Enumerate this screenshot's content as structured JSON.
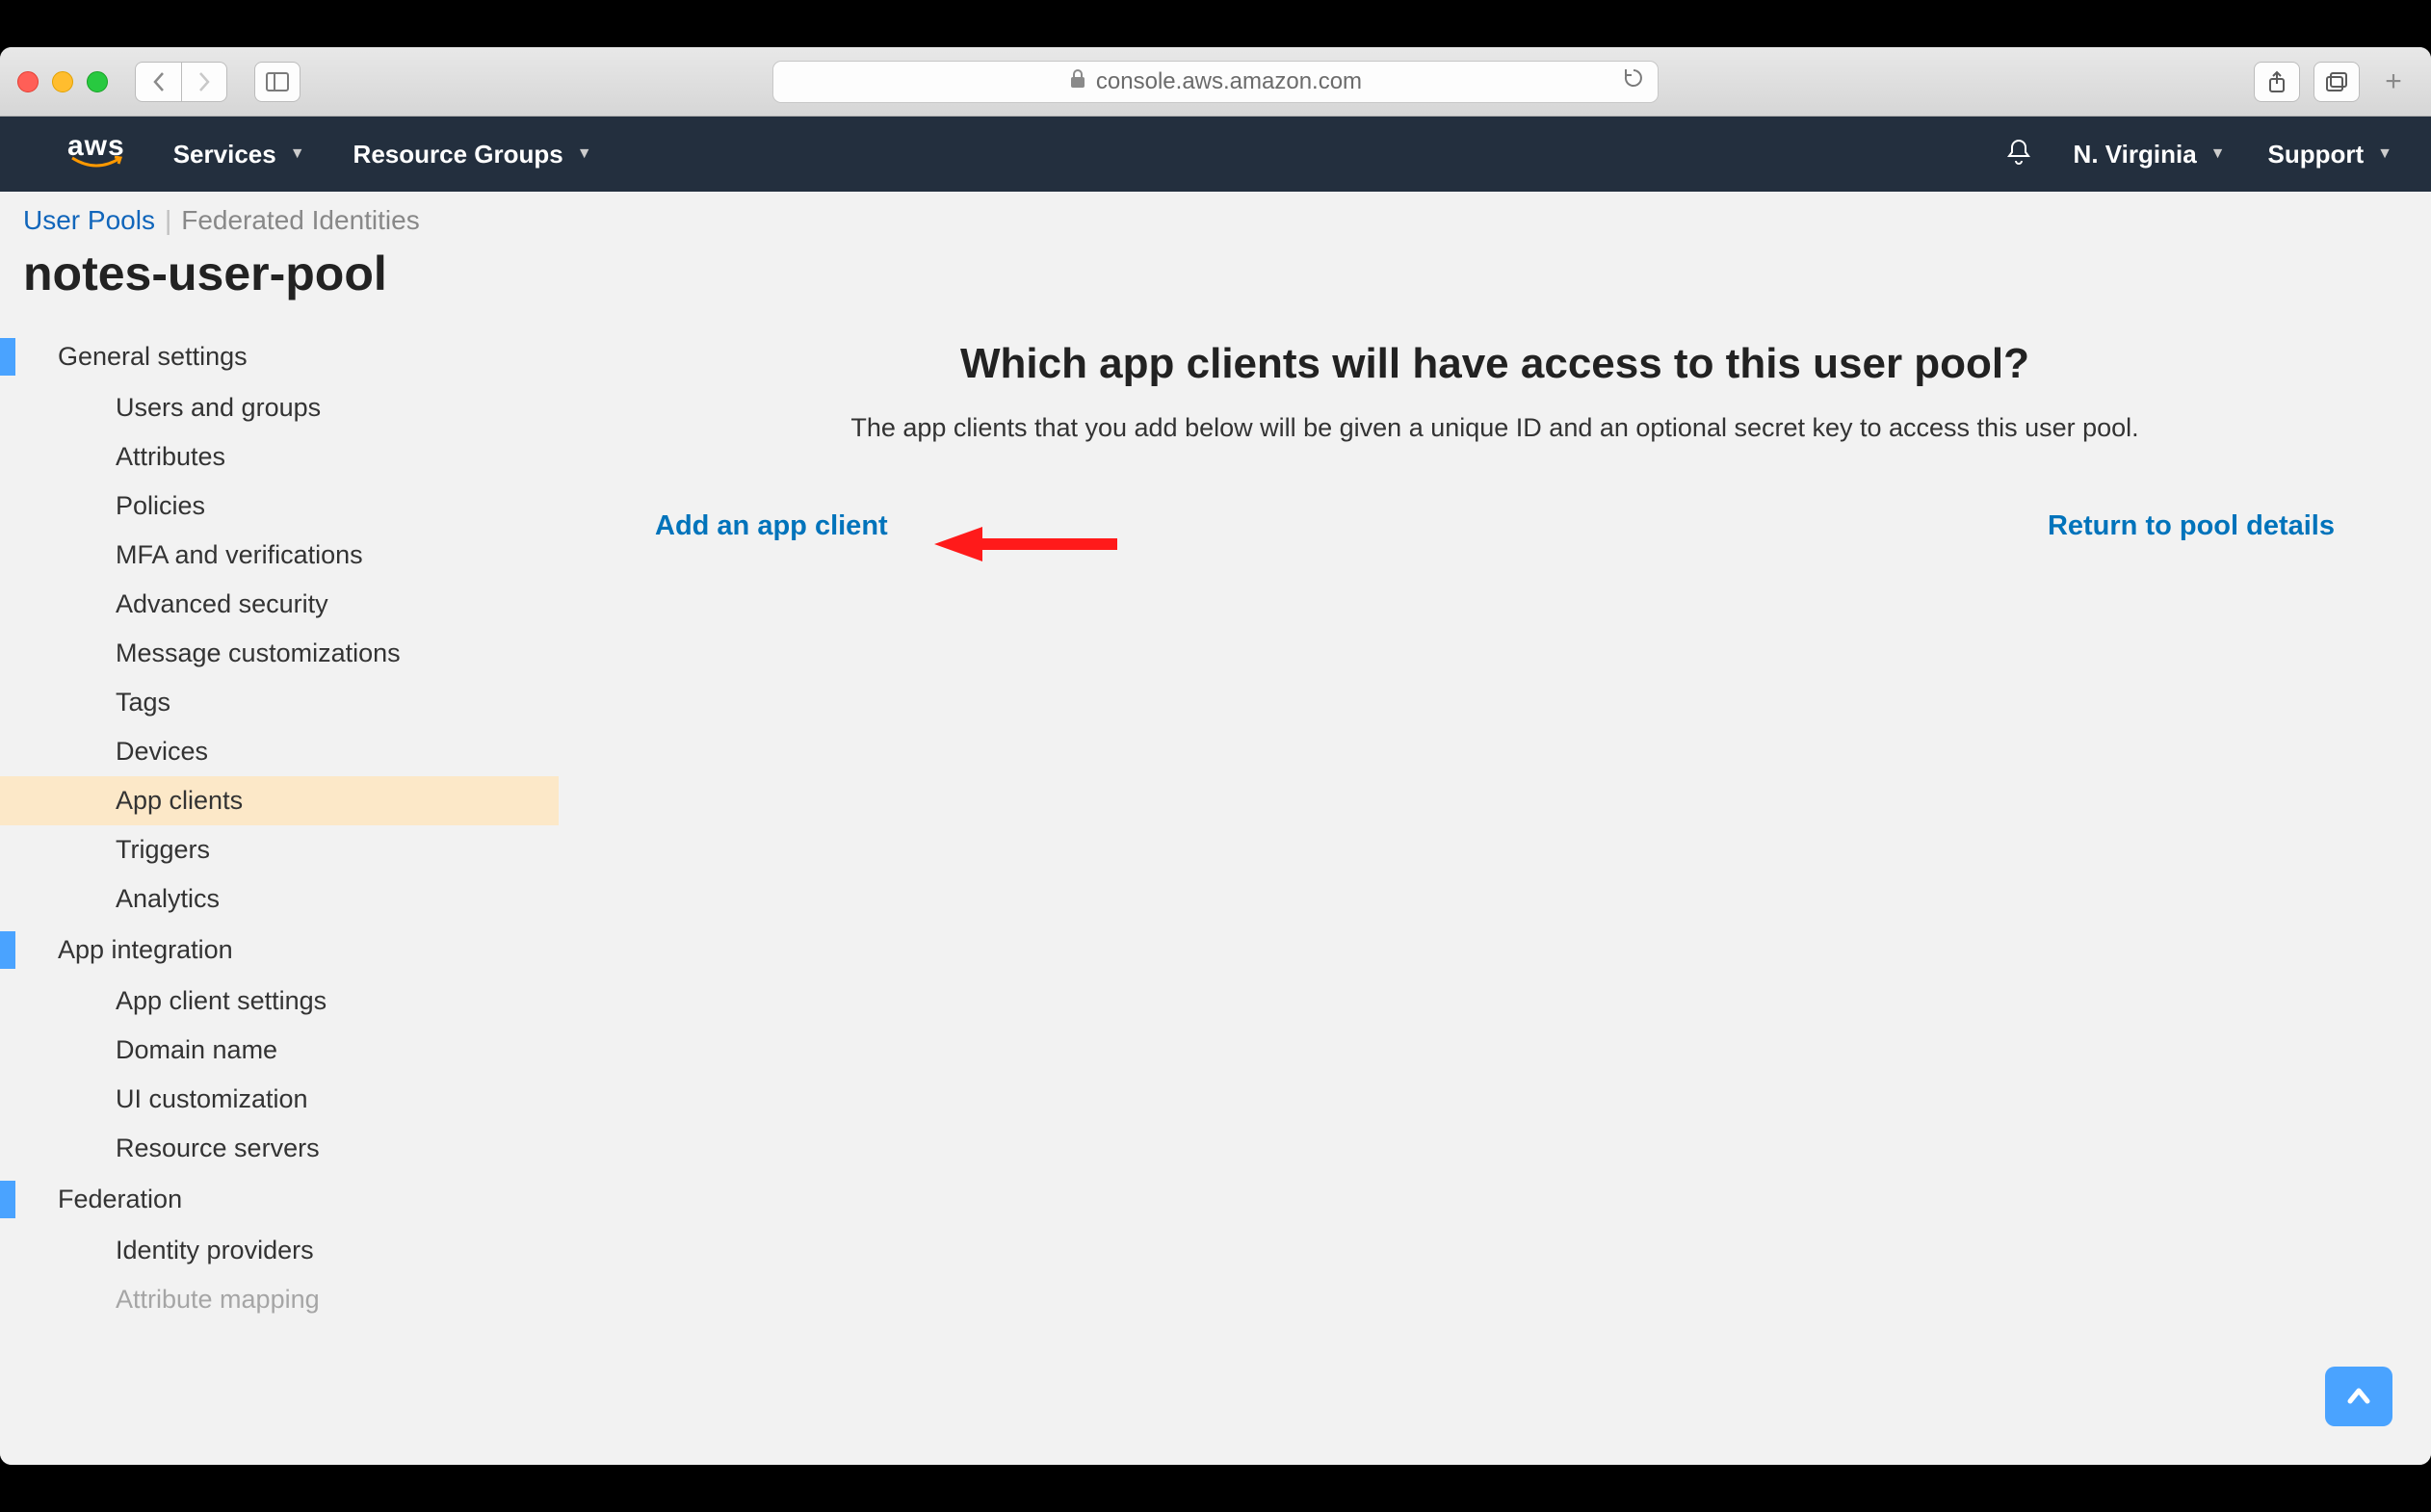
{
  "browser": {
    "url_host": "console.aws.amazon.com"
  },
  "nav": {
    "logo_text": "aws",
    "services": "Services",
    "resource_groups": "Resource Groups",
    "region": "N. Virginia",
    "support": "Support"
  },
  "subtabs": {
    "user_pools": "User Pools",
    "federated": "Federated Identities"
  },
  "pool_title": "notes-user-pool",
  "sidebar": {
    "groups": [
      {
        "label": "General settings",
        "highlighted": true,
        "items": [
          "Users and groups",
          "Attributes",
          "Policies",
          "MFA and verifications",
          "Advanced security",
          "Message customizations",
          "Tags",
          "Devices",
          "App clients",
          "Triggers",
          "Analytics"
        ],
        "active_index": 8
      },
      {
        "label": "App integration",
        "highlighted": true,
        "items": [
          "App client settings",
          "Domain name",
          "UI customization",
          "Resource servers"
        ]
      },
      {
        "label": "Federation",
        "highlighted": true,
        "items": [
          "Identity providers",
          "Attribute mapping"
        ]
      }
    ]
  },
  "content": {
    "heading": "Which app clients will have access to this user pool?",
    "description": "The app clients that you add below will be given a unique ID and an optional secret key to access this user pool.",
    "add_link": "Add an app client",
    "return_link": "Return to pool details"
  }
}
